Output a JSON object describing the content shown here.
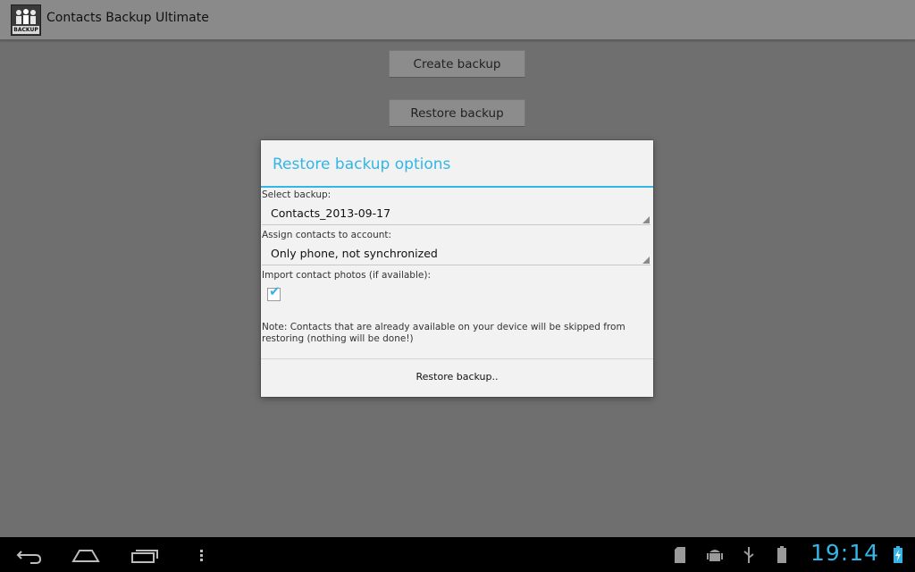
{
  "app": {
    "title": "Contacts Backup Ultimate",
    "icon_tag": "BACKUP"
  },
  "main": {
    "create_label": "Create backup",
    "restore_label": "Restore backup"
  },
  "dialog": {
    "title": "Restore backup options",
    "select_label": "Select backup:",
    "select_value": "Contacts_2013-09-17",
    "account_label": "Assign contacts to account:",
    "account_value": "Only phone, not synchronized",
    "photos_label": "Import contact photos (if available):",
    "photos_checked": true,
    "note": "Note: Contacts that are already available on your device will be skipped from restoring (nothing will be done!)",
    "restore_button": "Restore backup.."
  },
  "status": {
    "time": "19:14"
  },
  "colors": {
    "accent": "#33b5e5",
    "dialog_bg": "#f2f2f2",
    "dim_bg": "#6f6f6f"
  },
  "icons": [
    "back-icon",
    "home-icon",
    "recent-apps-icon",
    "menu-icon",
    "sd-card-icon",
    "android-debug-icon",
    "usb-icon",
    "battery-icon",
    "battery-charging-icon"
  ]
}
